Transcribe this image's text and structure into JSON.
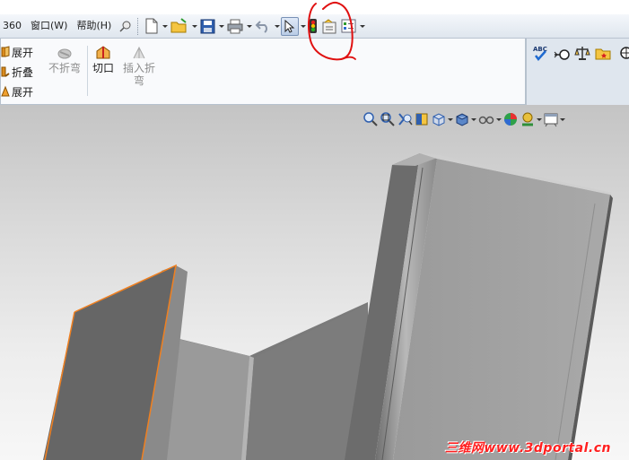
{
  "menubar": {
    "items": [
      "360",
      "窗口(W)",
      "帮助(H)"
    ]
  },
  "command_manager": {
    "small_tools": [
      {
        "label": "展开",
        "icon": "unfold-icon"
      },
      {
        "label": "折叠",
        "icon": "fold-icon"
      },
      {
        "label": "展开",
        "icon": "flatten-icon"
      }
    ],
    "unbend": {
      "label": "不折弯",
      "enabled": false
    },
    "cut": {
      "label": "切口"
    },
    "insert_bends": {
      "label_line1": "插入折",
      "label_line2": "弯",
      "enabled": false
    }
  },
  "right_tools": [
    "spelling-check-icon",
    "hole-callout-icon",
    "balance-icon",
    "folder-star-icon",
    "circle-icon"
  ],
  "heads_up_tools": [
    "zoom-to-fit-icon",
    "zoom-area-icon",
    "previous-view-icon",
    "section-view-icon",
    "view-orientation-icon",
    "display-style-icon",
    "hide-show-icon",
    "edit-appearance-icon",
    "apply-scene-icon",
    "view-settings-icon"
  ],
  "watermark": {
    "text": "三维网www.3dportal.cn"
  },
  "colors": {
    "annotation": "#e01010",
    "watermark": "#ff2020",
    "edge_highlight": "#f08020"
  }
}
